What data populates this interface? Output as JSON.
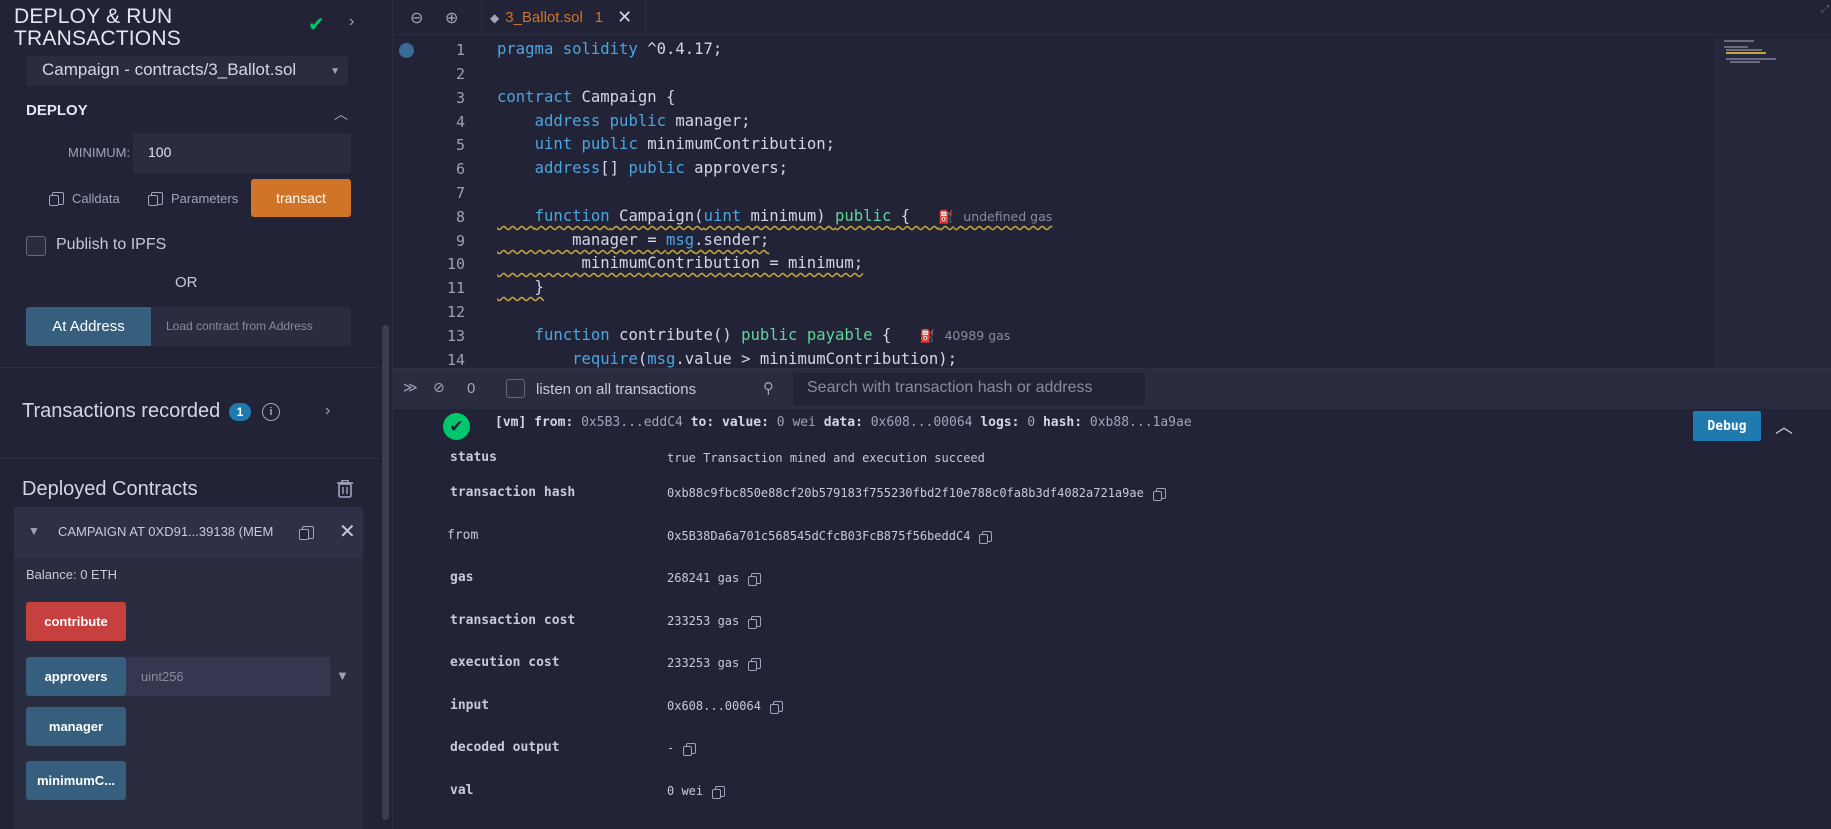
{
  "left_panel": {
    "title": "DEPLOY & RUN TRANSACTIONS",
    "contract_select": "Campaign - contracts/3_Ballot.sol",
    "deploy": {
      "header": "DEPLOY",
      "minimum_label": "MINIMUM:",
      "minimum_value": "100",
      "calldata_label": "Calldata",
      "parameters_label": "Parameters",
      "transact_label": "transact"
    },
    "publish_label": "Publish to IPFS",
    "or_label": "OR",
    "at_address_label": "At Address",
    "address_placeholder": "Load contract from Address",
    "transactions_recorded": "Transactions recorded",
    "transactions_count": "1",
    "deployed_contracts": "Deployed Contracts",
    "instance": {
      "name": "CAMPAIGN AT 0XD91...39138 (MEM",
      "balance": "Balance: 0 ETH",
      "functions": [
        {
          "label": "contribute"
        },
        {
          "label": "approvers",
          "placeholder": "uint256"
        },
        {
          "label": "manager"
        },
        {
          "label": "minimumC..."
        }
      ]
    }
  },
  "editor": {
    "tab_name": "3_Ballot.sol",
    "tab_badge": "1",
    "line_numbers": [
      "1",
      "2",
      "3",
      "4",
      "5",
      "6",
      "7",
      "8",
      "9",
      "10",
      "11",
      "12",
      "13",
      "14"
    ],
    "gas_note_constructor": "undefined gas",
    "gas_note_contribute": "40989 gas"
  },
  "terminal": {
    "count": "0",
    "listen_label": "listen on all transactions",
    "search_placeholder": "Search with transaction hash or address",
    "tx_summary": {
      "vm": "[vm]",
      "from_label": "from:",
      "from_value": "0x5B3...eddC4",
      "to_label": "to:",
      "value_label": "value:",
      "value_value": "0 wei",
      "data_label": "data:",
      "data_value": "0x608...00064",
      "logs_label": "logs:",
      "logs_value": "0",
      "hash_label": "hash:",
      "hash_value": "0xb88...1a9ae"
    },
    "debug_label": "Debug",
    "details": [
      {
        "key": "status",
        "value": "true Transaction mined and execution succeed"
      },
      {
        "key": "transaction hash",
        "value": "0xb88c9fbc850e88cf20b579183f755230fbd2f10e788c0fa8b3df4082a721a9ae"
      },
      {
        "key": "from",
        "value": "0x5B38Da6a701c568545dCfcB03FcB875f56beddC4"
      },
      {
        "key": "gas",
        "value": "268241 gas"
      },
      {
        "key": "transaction cost",
        "value": "233253 gas"
      },
      {
        "key": "execution cost",
        "value": "233253 gas"
      },
      {
        "key": "input",
        "value": "0x608...00064"
      },
      {
        "key": "decoded output",
        "value": "-"
      },
      {
        "key": "val",
        "value": "0 wei"
      }
    ]
  },
  "colors": {
    "background": "#222336",
    "panel": "#2a2c3f",
    "transact": "#d07427",
    "contribute": "#c5403f",
    "call": "#355f7d",
    "success": "#00c76b",
    "keyword": "#4aa6e0"
  }
}
